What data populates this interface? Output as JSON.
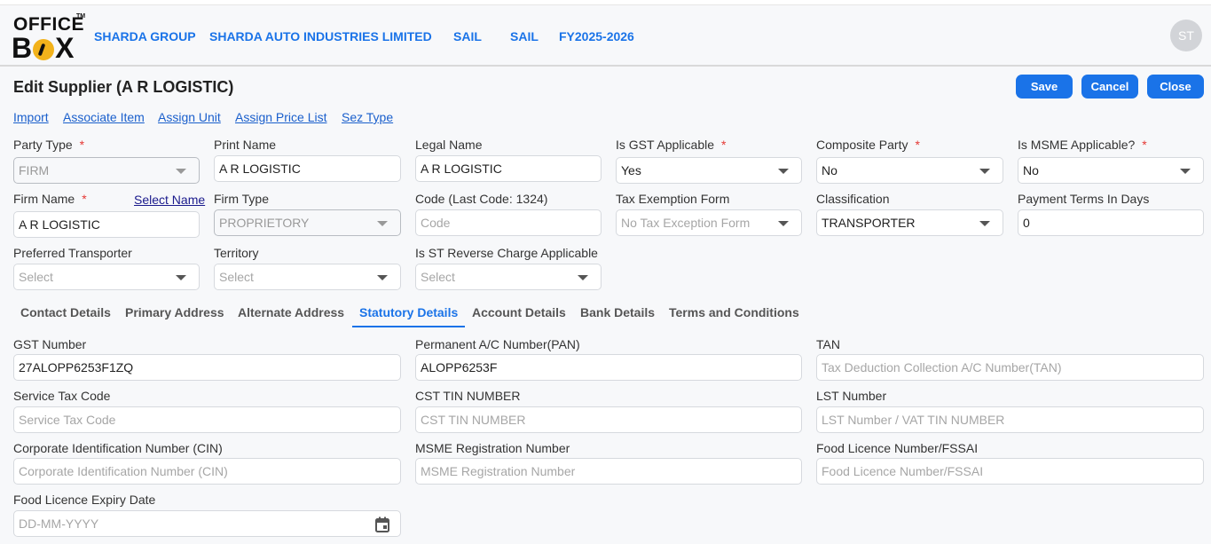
{
  "header": {
    "logo_line1": "OFFICE",
    "logo_tm": "TM",
    "logo_line2_b": "B",
    "logo_line2_x": "X",
    "nav": [
      "SHARDA GROUP",
      "SHARDA AUTO INDUSTRIES LIMITED",
      "SAIL",
      "SAIL",
      "FY2025-2026"
    ],
    "avatar_initials": "ST"
  },
  "page": {
    "title": "Edit Supplier (A R LOGISTIC)",
    "buttons": {
      "save": "Save",
      "cancel": "Cancel",
      "close": "Close"
    },
    "links": [
      "Import",
      "Associate Item",
      "Assign Unit",
      "Assign Price List",
      "Sez Type"
    ]
  },
  "form": {
    "party_type": {
      "label": "Party Type",
      "value": "FIRM"
    },
    "print_name": {
      "label": "Print Name",
      "value": "A R LOGISTIC"
    },
    "legal_name": {
      "label": "Legal Name",
      "value": "A R LOGISTIC"
    },
    "is_gst_applicable": {
      "label": "Is GST Applicable",
      "value": "Yes"
    },
    "composite_party": {
      "label": "Composite Party",
      "value": "No"
    },
    "is_msme_applicable": {
      "label": "Is MSME Applicable?",
      "value": "No"
    },
    "firm_name": {
      "label": "Firm Name",
      "value": "A R LOGISTIC",
      "select_link": "Select Name"
    },
    "firm_type": {
      "label": "Firm Type",
      "value": "PROPRIETORY"
    },
    "code": {
      "label": "Code (Last Code: 1324)",
      "placeholder": "Code"
    },
    "tax_exemption_form": {
      "label": "Tax Exemption Form",
      "placeholder": "No Tax Exception Form"
    },
    "classification": {
      "label": "Classification",
      "value": "TRANSPORTER"
    },
    "payment_terms": {
      "label": "Payment Terms In Days",
      "value": "0"
    },
    "preferred_transporter": {
      "label": "Preferred Transporter",
      "placeholder": "Select"
    },
    "territory": {
      "label": "Territory",
      "placeholder": "Select"
    },
    "st_reverse_charge": {
      "label": "Is ST Reverse Charge Applicable",
      "placeholder": "Select"
    },
    "required_mark": "*"
  },
  "tabs": [
    "Contact Details",
    "Primary Address",
    "Alternate Address",
    "Statutory Details",
    "Account Details",
    "Bank Details",
    "Terms and Conditions"
  ],
  "statutory": {
    "gst_number": {
      "label": "GST Number",
      "value": "27ALOPP6253F1ZQ"
    },
    "pan": {
      "label": "Permanent A/C Number(PAN)",
      "value": "ALOPP6253F"
    },
    "tan": {
      "label": "TAN",
      "placeholder": "Tax Deduction Collection A/C Number(TAN)"
    },
    "service_tax_code": {
      "label": "Service Tax Code",
      "placeholder": "Service Tax Code"
    },
    "cst_tin": {
      "label": "CST TIN NUMBER",
      "placeholder": "CST TIN NUMBER"
    },
    "lst_number": {
      "label": "LST Number",
      "placeholder": "LST Number / VAT TIN NUMBER"
    },
    "cin": {
      "label": "Corporate Identification Number (CIN)",
      "placeholder": "Corporate Identification Number (CIN)"
    },
    "msme_reg": {
      "label": "MSME Registration Number",
      "placeholder": "MSME Registration Number"
    },
    "fssai": {
      "label": "Food Licence Number/FSSAI",
      "placeholder": "Food Licence Number/FSSAI"
    },
    "food_expiry": {
      "label": "Food Licence Expiry Date",
      "placeholder": "DD-MM-YYYY"
    }
  },
  "colors": {
    "accent": "#1a73e8",
    "required": "#e53935",
    "logo_yellow": "#f2b21b"
  }
}
